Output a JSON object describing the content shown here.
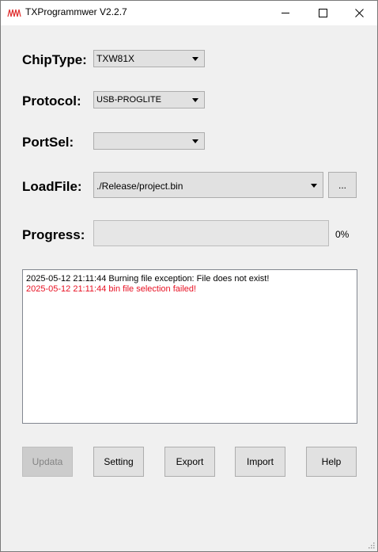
{
  "window": {
    "title": "TXProgrammwer V2.2.7",
    "icon": "waveform-icon"
  },
  "form": {
    "chip_type": {
      "label": "ChipType:",
      "value": "TXW81X"
    },
    "protocol": {
      "label": "Protocol:",
      "value": "USB-PROGLITE"
    },
    "port_sel": {
      "label": "PortSel:",
      "value": ""
    },
    "load_file": {
      "label": "LoadFile:",
      "value": "./Release/project.bin",
      "browse_label": "..."
    },
    "progress": {
      "label": "Progress:",
      "percent": 0,
      "text": "0%"
    }
  },
  "log": {
    "lines": [
      {
        "text": "2025-05-12 21:11:44 Burning file exception: File does not exist!",
        "color": "#000000"
      },
      {
        "text": "2025-05-12 21:11:44 bin file selection failed!",
        "color": "#e81123"
      }
    ]
  },
  "buttons": {
    "updata": "Updata",
    "setting": "Setting",
    "export": "Export",
    "import": "Import",
    "help": "Help"
  }
}
